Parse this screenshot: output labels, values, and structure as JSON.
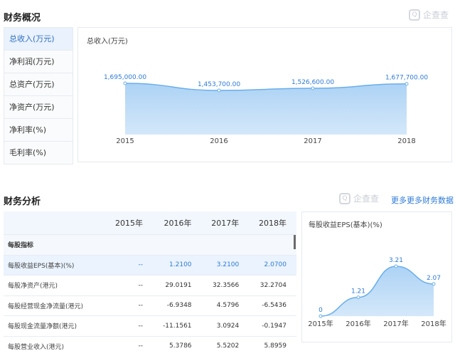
{
  "overview": {
    "title": "财务概况",
    "watermark": "企查查",
    "menu": [
      {
        "label": "总收入(万元)",
        "active": true
      },
      {
        "label": "净利润(万元)",
        "active": false
      },
      {
        "label": "总资产(万元)",
        "active": false
      },
      {
        "label": "净资产(万元)",
        "active": false
      },
      {
        "label": "净利率(%)",
        "active": false
      },
      {
        "label": "毛利率(%)",
        "active": false
      }
    ]
  },
  "analysis": {
    "title": "财务分析",
    "watermark": "企查查",
    "more_link": "更多更多财务数据 >",
    "table": {
      "columns": [
        "",
        "2015年",
        "2016年",
        "2017年",
        "2018年"
      ],
      "group_label": "每股指标",
      "rows": [
        {
          "label": "每股收益EPS(基本)(%)",
          "values": [
            "--",
            "1.2100",
            "3.2100",
            "2.0700"
          ],
          "highlight": true
        },
        {
          "label": "每股净资产(港元)",
          "values": [
            "--",
            "29.0191",
            "32.3566",
            "32.2704"
          ],
          "highlight": false
        },
        {
          "label": "每股经营现金净流量(港元)",
          "values": [
            "--",
            "-6.9348",
            "4.5796",
            "-6.5436"
          ],
          "highlight": false
        },
        {
          "label": "每股现金流量净额(港元)",
          "values": [
            "--",
            "-11.1561",
            "3.0924",
            "-0.1947"
          ],
          "highlight": false
        },
        {
          "label": "每股营业收入(港元)",
          "values": [
            "--",
            "5.3786",
            "5.5202",
            "5.8959"
          ],
          "highlight": false
        }
      ]
    }
  },
  "chart_data": [
    {
      "type": "area",
      "title": "总收入(万元)",
      "x": [
        "2015",
        "2016",
        "2017",
        "2018"
      ],
      "values": [
        1695000.0,
        1453700.0,
        1526600.0,
        1677700.0
      ],
      "data_labels": [
        "1,695,000.00",
        "1,453,700.00",
        "1,526,600.00",
        "1,677,700.00"
      ],
      "grid": false,
      "color": "#6aaeea"
    },
    {
      "type": "area",
      "title": "每股收益EPS(基本)(%)",
      "x": [
        "2015年",
        "2016年",
        "2017年",
        "2018年"
      ],
      "values": [
        0,
        1.21,
        3.21,
        2.07
      ],
      "data_labels": [
        "0",
        "1.21",
        "3.21",
        "2.07"
      ],
      "grid": false,
      "color": "#6aaeea"
    }
  ]
}
